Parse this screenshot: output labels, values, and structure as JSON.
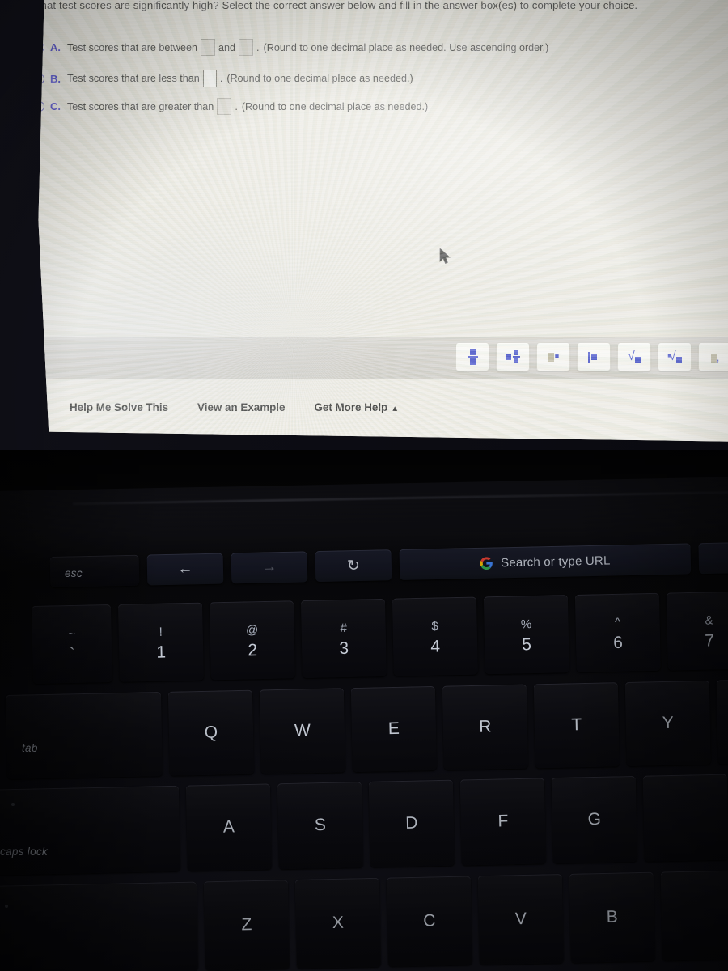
{
  "screen": {
    "question": "What test scores are significantly high? Select the correct answer below and fill in the answer box(es) to complete your choice.",
    "choices": [
      {
        "letter": "A.",
        "selected": false,
        "text_before": "Test scores that are between",
        "text_middle": "and",
        "text_after": "",
        "hint": "(Round to one decimal place as needed. Use ascending order.)",
        "boxes": 2,
        "box_value": ""
      },
      {
        "letter": "B.",
        "selected": true,
        "text_before": "Test scores that are less than",
        "text_middle": "",
        "text_after": "",
        "hint": "(Round to one decimal place as needed.)",
        "boxes": 1,
        "box_value": ""
      },
      {
        "letter": "C.",
        "selected": false,
        "text_before": "Test scores that are greater than",
        "text_middle": "",
        "text_after": "",
        "hint": "(Round to one decimal place as needed.)",
        "boxes": 1,
        "box_value": ""
      }
    ],
    "period": ".",
    "math_toolbar": [
      {
        "name": "fraction-button",
        "symbol": "■/■"
      },
      {
        "name": "mixed-number-button",
        "symbol": "■ ■/■"
      },
      {
        "name": "exponent-button",
        "symbol": "■•"
      },
      {
        "name": "absolute-value-button",
        "symbol": "|■|"
      },
      {
        "name": "square-root-button",
        "symbol": "√■"
      },
      {
        "name": "nth-root-button",
        "symbol": "∛■"
      },
      {
        "name": "decimal-button",
        "symbol": "■."
      }
    ],
    "help_links": [
      {
        "label": "Help Me Solve This"
      },
      {
        "label": "View an Example"
      },
      {
        "label": "Get More Help",
        "caret": "▲"
      }
    ],
    "accent_color": "#3a36c8",
    "background_color": "#e8e6de",
    "toolbar_band_color": "#cdcbc5"
  },
  "keyboard": {
    "esc_label": "esc",
    "tab_label": "tab",
    "caps_label": "caps lock",
    "function_keys": [
      {
        "name": "back-key",
        "glyph": "←"
      },
      {
        "name": "forward-key",
        "glyph": "→"
      },
      {
        "name": "reload-key",
        "glyph": "↻"
      }
    ],
    "url_key": {
      "name": "search-or-type-url-key",
      "label": "Search or type URL",
      "icon": "google-g-icon"
    },
    "number_row": [
      {
        "upper": "~",
        "lower": "`"
      },
      {
        "upper": "!",
        "lower": "1"
      },
      {
        "upper": "@",
        "lower": "2"
      },
      {
        "upper": "#",
        "lower": "3"
      },
      {
        "upper": "$",
        "lower": "4"
      },
      {
        "upper": "%",
        "lower": "5"
      },
      {
        "upper": "^",
        "lower": "6"
      },
      {
        "upper": "&",
        "lower": "7"
      }
    ],
    "qwerty_row": [
      "Q",
      "W",
      "E",
      "R",
      "T",
      "Y"
    ],
    "home_row": [
      "A",
      "S",
      "D",
      "F",
      "G"
    ],
    "bottom_row": [
      "Z",
      "X",
      "C",
      "V",
      "B"
    ]
  }
}
